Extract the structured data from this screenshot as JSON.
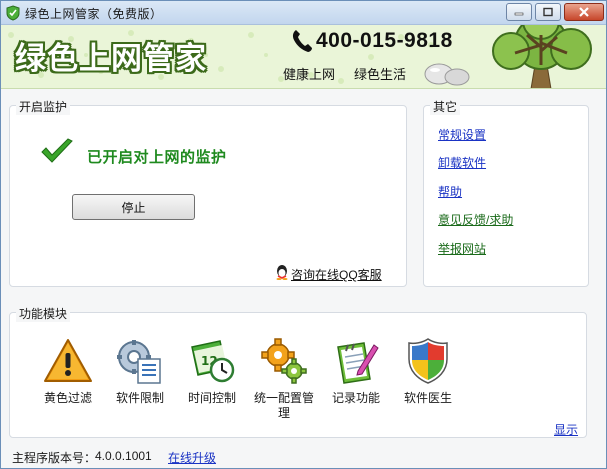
{
  "window": {
    "title": "绿色上网管家（免费版）"
  },
  "banner": {
    "logo": "绿色上网管家",
    "phone": "400-015-9818",
    "slogans": [
      "健康上网",
      "绿色生活"
    ]
  },
  "monitor": {
    "group_title": "开启监护",
    "status": "已开启对上网的监护",
    "stop_label": "停止",
    "qq_link": "咨询在线QQ客服"
  },
  "other": {
    "group_title": "其它",
    "links": [
      "常规设置",
      "卸载软件",
      "帮助",
      "意见反馈/求助",
      "举报网站"
    ]
  },
  "modules": {
    "group_title": "功能模块",
    "items": [
      {
        "label": "黄色过滤",
        "icon": "warning-icon"
      },
      {
        "label": "软件限制",
        "icon": "software-limit-icon"
      },
      {
        "label": "时间控制",
        "icon": "calendar-clock-icon"
      },
      {
        "label": "统一配置管\n理",
        "icon": "gears-icon"
      },
      {
        "label": "记录功能",
        "icon": "notepad-icon"
      },
      {
        "label": "软件医生",
        "icon": "shield-icon"
      }
    ],
    "show_link": "显示"
  },
  "footer": {
    "version_label": "主程序版本号：",
    "version_value": "4.0.0.1001",
    "upgrade_link": "在线升级"
  },
  "colors": {
    "status_green": "#1f8a1f",
    "link_blue": "#1a33c4",
    "banner_bg": "#eaf5d8"
  }
}
